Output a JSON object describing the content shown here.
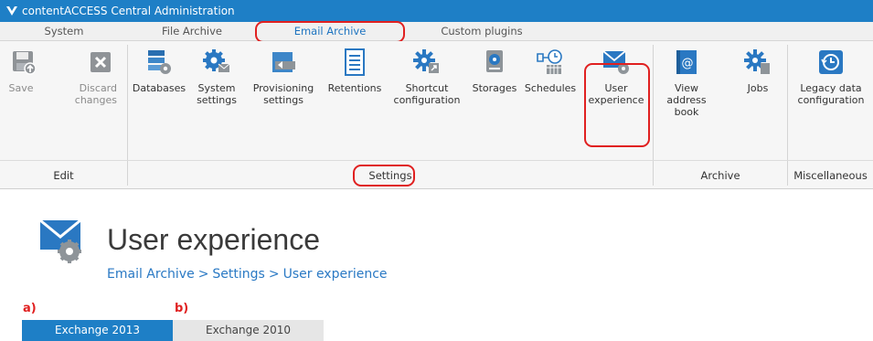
{
  "window": {
    "title": "contentACCESS Central Administration"
  },
  "tabs": [
    {
      "label": "System"
    },
    {
      "label": "File Archive"
    },
    {
      "label": "Email Archive"
    },
    {
      "label": "Custom plugins"
    }
  ],
  "ribbon": {
    "edit": {
      "save": "Save",
      "discard": "Discard changes",
      "group": "Edit"
    },
    "settings": {
      "databases": "Databases",
      "system_settings": "System settings",
      "provisioning_settings": "Provisioning settings",
      "retentions": "Retentions",
      "shortcut_configuration": "Shortcut configuration",
      "storages": "Storages",
      "schedules": "Schedules",
      "user_experience": "User experience",
      "group": "Settings"
    },
    "archive": {
      "view_address_book": "View address book",
      "jobs": "Jobs",
      "group": "Archive"
    },
    "misc": {
      "legacy_data": "Legacy data configuration",
      "group": "Miscellaneous"
    }
  },
  "page": {
    "title": "User experience",
    "breadcrumb": [
      "Email Archive",
      "Settings",
      "User experience"
    ],
    "breadcrumb_sep": ">"
  },
  "annotations": {
    "a": "a)",
    "b": "b)"
  },
  "subtabs": [
    {
      "label": "Exchange 2013"
    },
    {
      "label": "Exchange 2010"
    }
  ],
  "colors": {
    "accent": "#1e7fc6",
    "highlight": "#e02020"
  }
}
